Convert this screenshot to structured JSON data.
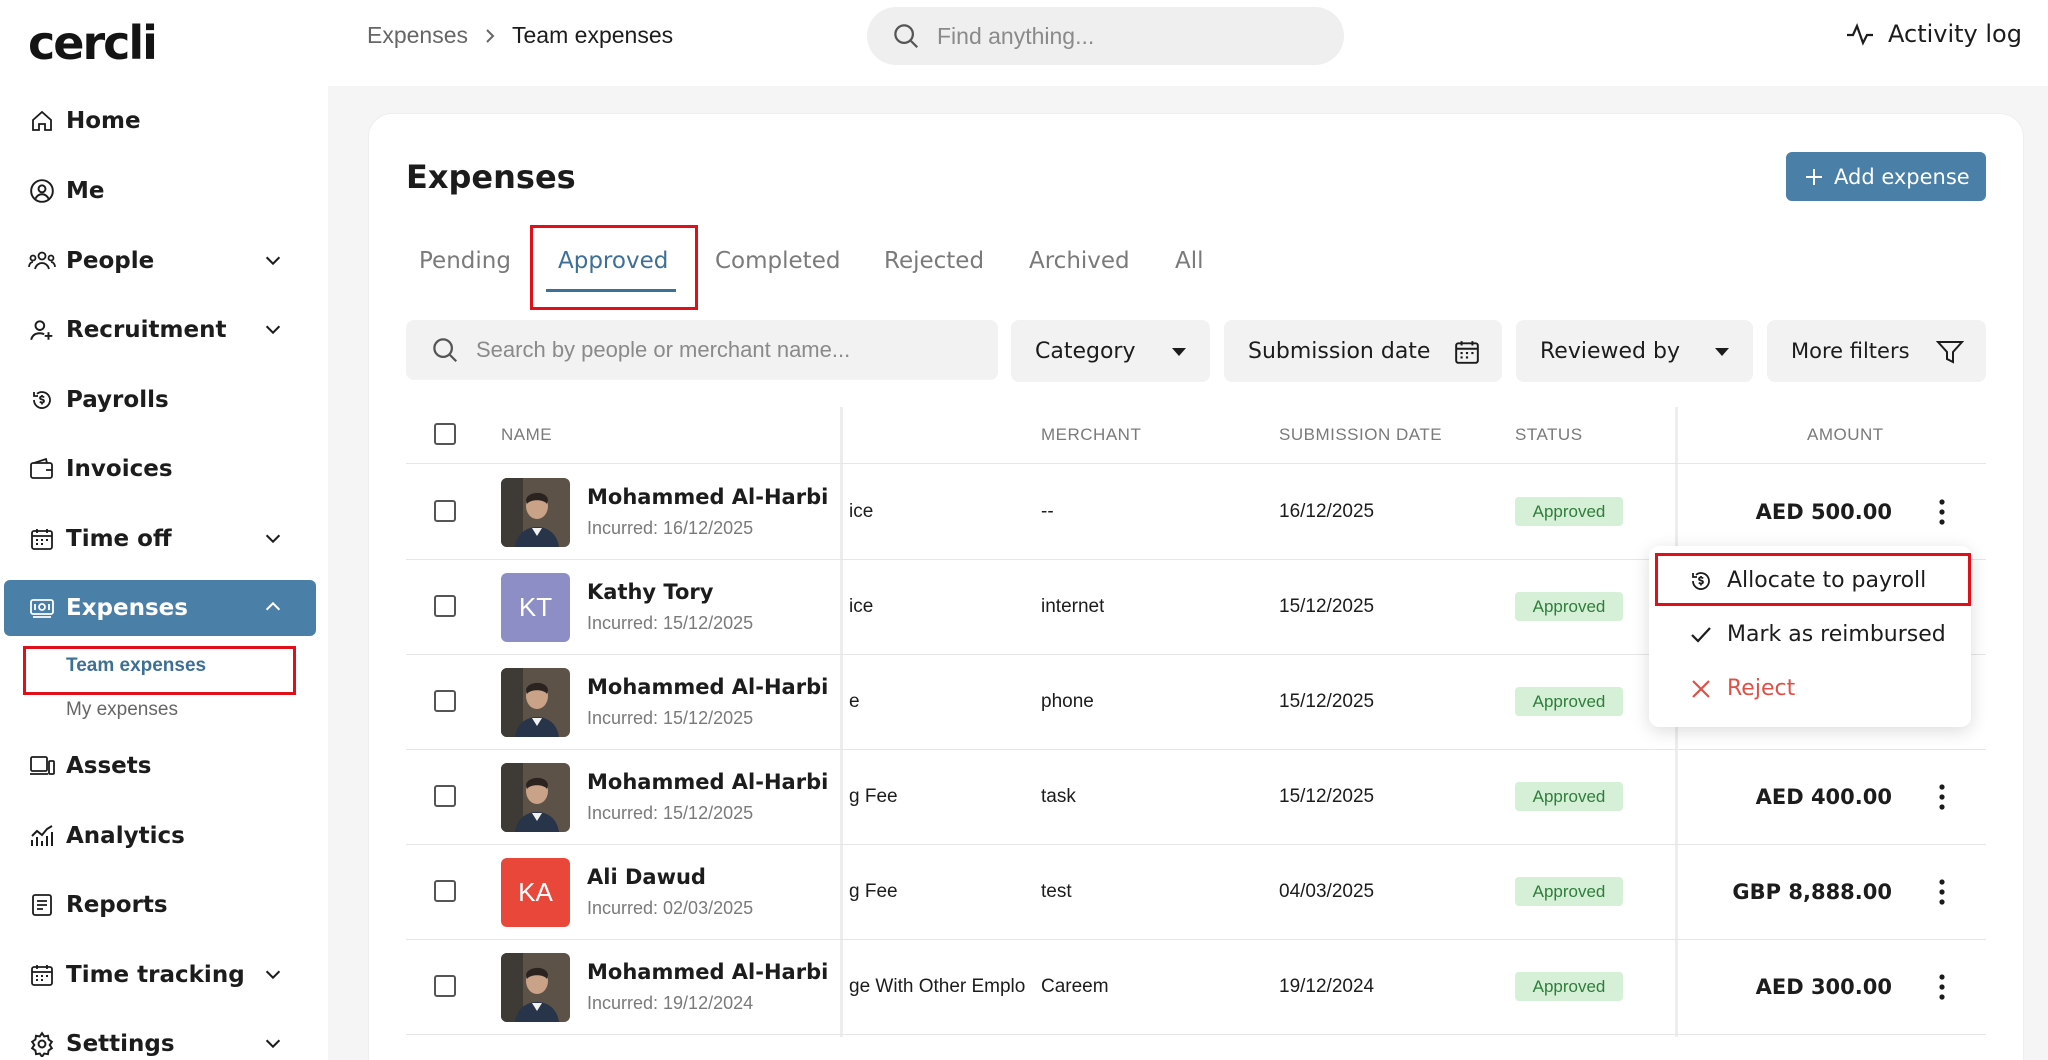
{
  "app": {
    "logo": "cercli"
  },
  "sidebar": {
    "items": [
      {
        "label": "Home",
        "icon": "home-icon",
        "expandable": false
      },
      {
        "label": "Me",
        "icon": "user-circle-icon",
        "expandable": false
      },
      {
        "label": "People",
        "icon": "people-icon",
        "expandable": true
      },
      {
        "label": "Recruitment",
        "icon": "user-plus-icon",
        "expandable": true
      },
      {
        "label": "Payrolls",
        "icon": "payroll-icon",
        "expandable": false
      },
      {
        "label": "Invoices",
        "icon": "wallet-icon",
        "expandable": false
      },
      {
        "label": "Time off",
        "icon": "calendar-icon",
        "expandable": true
      },
      {
        "label": "Expenses",
        "icon": "money-icon",
        "expandable": true,
        "active": true
      },
      {
        "label": "Assets",
        "icon": "laptop-icon",
        "expandable": false
      },
      {
        "label": "Analytics",
        "icon": "analytics-icon",
        "expandable": false
      },
      {
        "label": "Reports",
        "icon": "report-icon",
        "expandable": false
      },
      {
        "label": "Time tracking",
        "icon": "calendar-icon",
        "expandable": true
      },
      {
        "label": "Settings",
        "icon": "gear-icon",
        "expandable": true
      }
    ],
    "expenses_sub": [
      {
        "label": "Team expenses",
        "active": true
      },
      {
        "label": "My expenses",
        "active": false
      }
    ]
  },
  "topbar": {
    "breadcrumb": [
      "Expenses",
      "Team expenses"
    ],
    "search_placeholder": "Find anything...",
    "activity_log": "Activity log"
  },
  "page": {
    "title": "Expenses",
    "add_button": "Add expense",
    "tabs": [
      "Pending",
      "Approved",
      "Completed",
      "Rejected",
      "Archived",
      "All"
    ],
    "active_tab": "Approved",
    "search_placeholder": "Search by people or merchant name...",
    "filters": [
      "Category",
      "Submission date",
      "Reviewed by",
      "More filters"
    ]
  },
  "table": {
    "columns": [
      "NAME",
      "MERCHANT",
      "SUBMISSION DATE",
      "STATUS",
      "AMOUNT"
    ],
    "rows": [
      {
        "name": "Mohammed Al-Harbi",
        "incurred": "Incurred: 16/12/2025",
        "avatar": "photo",
        "desc": "ice",
        "merchant": "--",
        "date": "16/12/2025",
        "status": "Approved",
        "amount": "AED 500.00"
      },
      {
        "name": "Kathy Tory",
        "incurred": "Incurred: 15/12/2025",
        "avatar": "KT",
        "avatar_color": "#8e8ec6",
        "desc": "ice",
        "merchant": "internet",
        "date": "15/12/2025",
        "status": "Approved",
        "amount": ""
      },
      {
        "name": "Mohammed Al-Harbi",
        "incurred": "Incurred: 15/12/2025",
        "avatar": "photo",
        "desc": "e",
        "merchant": "phone",
        "date": "15/12/2025",
        "status": "Approved",
        "amount": ""
      },
      {
        "name": "Mohammed Al-Harbi",
        "incurred": "Incurred: 15/12/2025",
        "avatar": "photo",
        "desc": "g Fee",
        "merchant": "task",
        "date": "15/12/2025",
        "status": "Approved",
        "amount": "AED 400.00"
      },
      {
        "name": "Ali Dawud",
        "incurred": "Incurred: 02/03/2025",
        "avatar": "KA",
        "avatar_color": "#e8473a",
        "desc": "g Fee",
        "merchant": "test",
        "date": "04/03/2025",
        "status": "Approved",
        "amount": "GBP 8,888.00"
      },
      {
        "name": "Mohammed Al-Harbi",
        "incurred": "Incurred: 19/12/2024",
        "avatar": "photo",
        "desc": "ge With Other Emplo",
        "merchant": "Careem",
        "date": "19/12/2024",
        "status": "Approved",
        "amount": "AED 300.00"
      }
    ]
  },
  "context_menu": {
    "items": [
      {
        "label": "Allocate to payroll",
        "icon": "payroll-icon"
      },
      {
        "label": "Mark as reimbursed",
        "icon": "check-icon"
      },
      {
        "label": "Reject",
        "icon": "close-icon"
      }
    ]
  },
  "colors": {
    "accent": "#4a7fa7",
    "highlight": "#e0101b",
    "badge_bg": "#d6f0d8",
    "badge_text": "#2f7d3a",
    "reject": "#e05047"
  }
}
